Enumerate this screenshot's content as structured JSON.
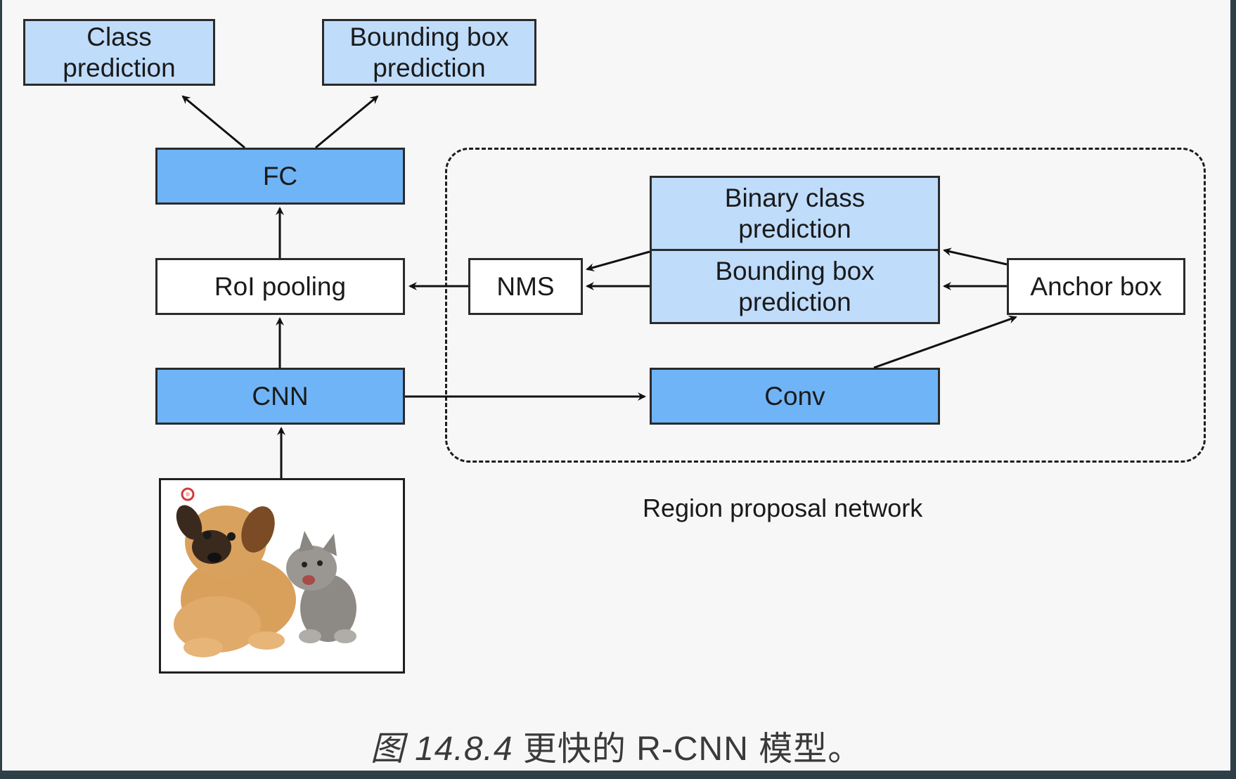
{
  "nodes": {
    "class_prediction": "Class\nprediction",
    "bbox_prediction_top": "Bounding box\nprediction",
    "fc": "FC",
    "roi_pooling": "RoI pooling",
    "cnn": "CNN",
    "nms": "NMS",
    "binary_class_prediction": "Binary class\nprediction",
    "bbox_prediction_rpn": "Bounding box\nprediction",
    "anchor_box": "Anchor box",
    "conv": "Conv"
  },
  "rpn_label": "Region proposal network",
  "caption": {
    "figure_number": "图 14.8.4",
    "text": "更快的 R-CNN 模型。"
  },
  "image_description_icon": "dog-and-kitten-photo",
  "colors": {
    "light_blue": "#bfdcfb",
    "medium_blue": "#6fb4f6",
    "background": "#f7f7f7"
  }
}
